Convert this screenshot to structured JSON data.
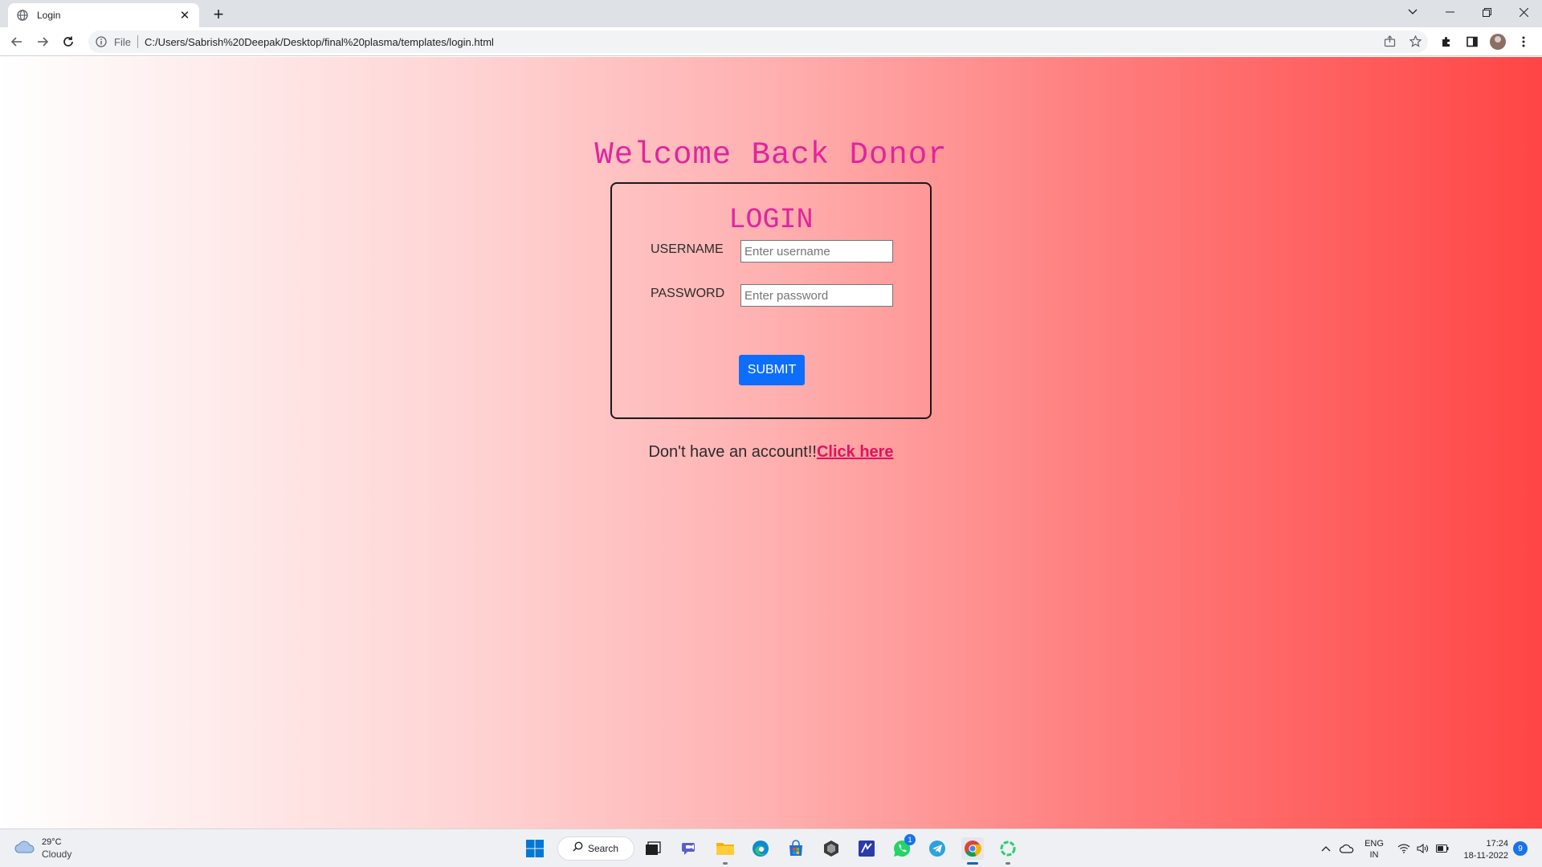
{
  "browser": {
    "tab_title": "Login",
    "tab_close": "✕",
    "new_tab": "+",
    "file_label": "File",
    "url": "C:/Users/Sabrish%20Deepak/Desktop/final%20plasma/templates/login.html"
  },
  "page": {
    "welcome": "Welcome Back Donor",
    "login_title": "LOGIN",
    "username_label": "USERNAME",
    "username_placeholder": "Enter username",
    "username_value": "",
    "password_label": "PASSWORD",
    "password_placeholder": "Enter password",
    "password_value": "",
    "submit_label": "SUBMIT",
    "signup_prefix": "Don't have an account!!",
    "signup_link": "Click here"
  },
  "taskbar": {
    "weather_temp": "29°C",
    "weather_cond": "Cloudy",
    "search_label": "Search",
    "whatsapp_badge": "1",
    "lang_line1": "ENG",
    "lang_line2": "IN",
    "time": "17:24",
    "date": "18-11-2022",
    "notification_count": "9"
  },
  "colors": {
    "heading": "#e0259f",
    "link": "#e0135d",
    "submit_bg": "#0d6efd",
    "gradient_start": "#ffffff",
    "gradient_end": "#ff4545"
  },
  "icons": {
    "tab_favicon": "globe-icon",
    "back": "back-arrow-icon",
    "forward": "forward-arrow-icon",
    "reload": "reload-icon",
    "site_info": "info-icon",
    "share": "share-icon",
    "bookmark": "star-icon",
    "extensions": "puzzle-icon",
    "side_panel": "side-panel-icon",
    "menu": "kebab-menu-icon"
  }
}
